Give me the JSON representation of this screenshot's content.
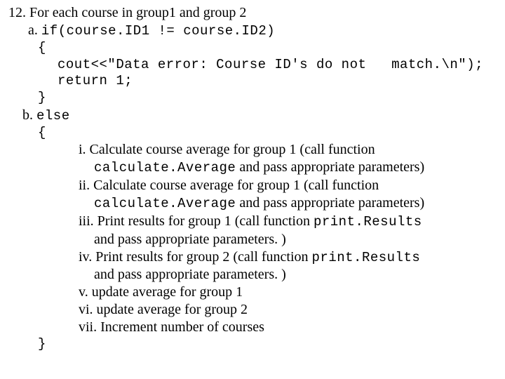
{
  "l12": "12. For each course in group1 and group 2",
  "a_label": "a. ",
  "a_code": "if(course.ID1 != course.ID2)",
  "brace_open": "{",
  "cout_line": "cout<<\"Data error: Course ID's do not   match.\\n\");",
  "return_line": "return 1;",
  "brace_close": "}",
  "b_label": "b. ",
  "else_kw": "else",
  "i_line1_a": "i. Calculate course average for group 1 (call function",
  "i_line2_code": "calculate.Average",
  "i_line2_b": " and pass appropriate parameters)",
  "ii_line1_a": "ii. Calculate course average for group 1 (call  function",
  "ii_line2_code": "calculate.Average",
  "ii_line2_b": " and pass appropriate parameters)",
  "iii_line1_a": "iii. Print results for group 1 (call function ",
  "iii_code": "print.Results",
  "iii_line2": "and pass appropriate parameters. )",
  "iv_line1_a": "iv. Print results for group 2 (call function ",
  "iv_code": "print.Results",
  "iv_line2": "and pass appropriate parameters. )",
  "v_line": "v. update average for group 1",
  "vi_line": "vi. update average for group 2",
  "vii_line": "vii. Increment number of courses"
}
